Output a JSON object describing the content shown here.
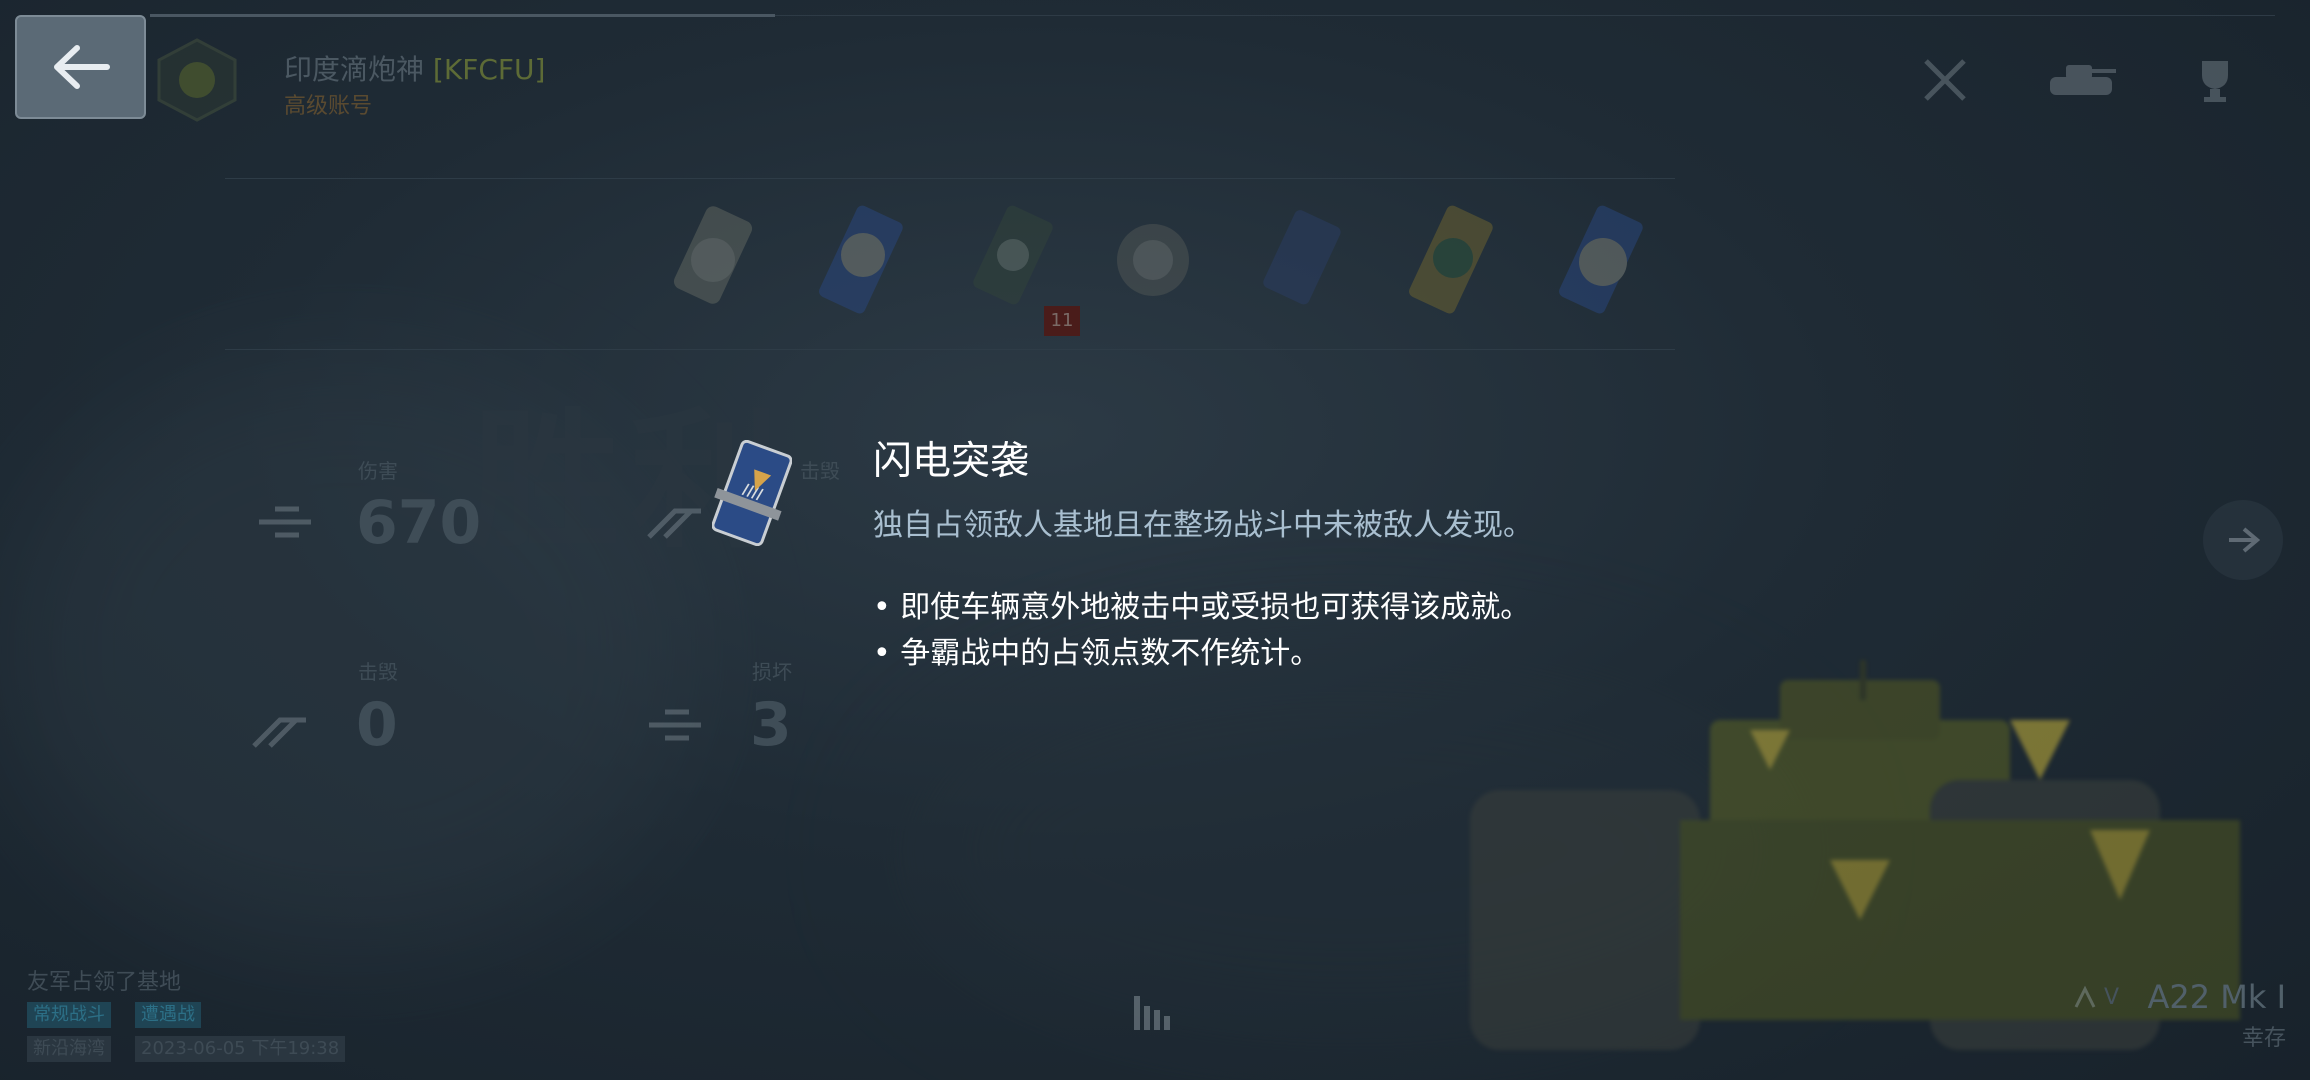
{
  "header": {
    "back_label": "back",
    "player_name": "印度滴炮神",
    "clan_tag": "[KFCFU]",
    "account_type": "高级账号"
  },
  "medals": {
    "count_badge": "11"
  },
  "watermark": "胜利",
  "stats": {
    "damage_label": "伤害",
    "damage_value": "670",
    "hits_label": "击毁",
    "kills_label": "击毁",
    "kills_value": "0",
    "blocked_label": "损坏",
    "blocked_value": "3"
  },
  "tooltip": {
    "title": "闪电突袭",
    "description": "独自占领敌人基地且在整场战斗中未被敌人发现。",
    "bullets": [
      "• 即使车辆意外地被击中或受损也可获得该成就。",
      "• 争霸战中的占领点数不作统计。"
    ]
  },
  "bottom": {
    "result_text": "友军占领了基地",
    "tag1": "常规战斗",
    "tag2": "遭遇战",
    "tag3": "新沿海湾",
    "datetime": "2023-06-05 下午19:38"
  },
  "vehicle": {
    "tier": "V",
    "name": "A22 Mk I",
    "status": "幸存"
  },
  "colors": {
    "accent_blue": "#a9bfd0",
    "background": "#1f2b35"
  }
}
